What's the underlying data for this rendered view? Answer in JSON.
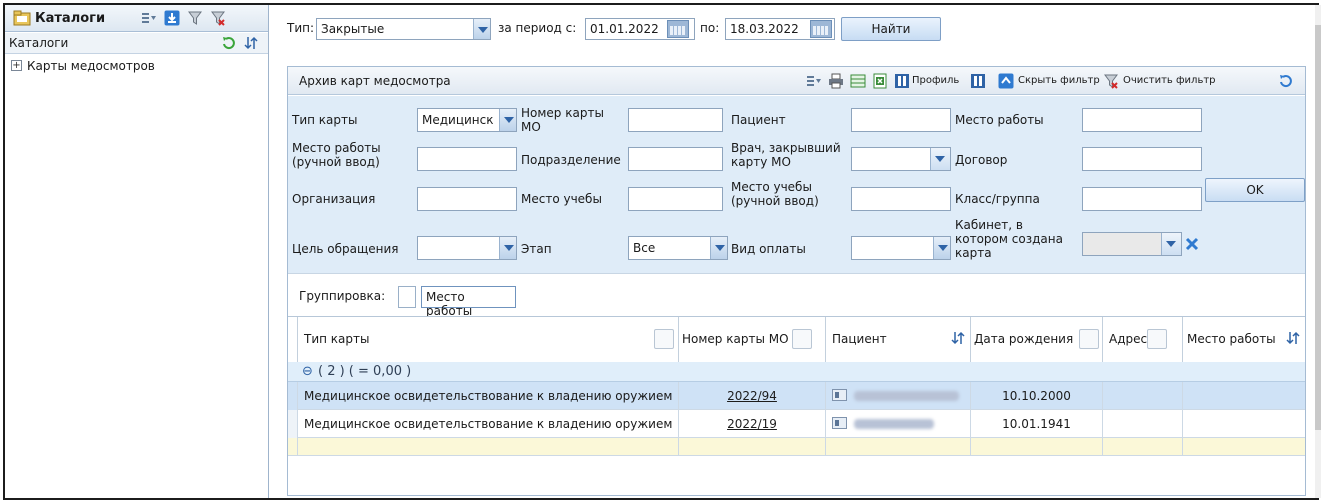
{
  "sidebar": {
    "title": "Каталоги",
    "header_label": "Каталоги",
    "tree": [
      {
        "label": "Карты медосмотров",
        "expander": "+"
      }
    ]
  },
  "toolbar": {
    "type_label": "Тип:",
    "type_value": "Закрытые",
    "period_from_label": "за период с:",
    "date_from": "01.01.2022",
    "period_to_label": "по:",
    "date_to": "18.03.2022",
    "find_button": "Найти"
  },
  "archive": {
    "title": "Архив карт медосмотра",
    "profile_label": "Профиль",
    "hide_filter_label": "Скрыть фильтр",
    "clear_filter_label": "Очистить фильтр"
  },
  "filter": {
    "card_type_label": "Тип карты",
    "card_type_value": "Медицинск",
    "card_number_label": "Номер карты МО",
    "patient_label": "Пациент",
    "workplace_label": "Место работы",
    "workplace_manual_label": "Место работы (ручной ввод)",
    "department_label": "Подразделение",
    "doctor_closed_label": "Врач, закрывший карту МО",
    "contract_label": "Договор",
    "organization_label": "Организация",
    "study_place_label": "Место учебы",
    "study_place_manual_label": "Место учебы (ручной ввод)",
    "class_group_label": "Класс/группа",
    "purpose_label": "Цель обращения",
    "stage_label": "Этап",
    "stage_value": "Все",
    "payment_label": "Вид оплаты",
    "cabinet_label": "Кабинет, в котором создана карта",
    "ok_button": "OK"
  },
  "grouping": {
    "label": "Группировка:",
    "chip": "Место работы"
  },
  "grid": {
    "columns": [
      "Тип карты",
      "Номер карты МО",
      "Пациент",
      "Дата рождения",
      "Адрес",
      "Место работы"
    ],
    "group_row": {
      "symbol": "⊖",
      "text": "( 2 ) ( = 0,00 )"
    },
    "rows": [
      {
        "type": "Медицинское освидетельствование к владению оружием",
        "number": "2022/94",
        "birth": "10.10.2000"
      },
      {
        "type": "Медицинское освидетельствование к владению оружием",
        "number": "2022/19",
        "birth": "10.01.1941"
      }
    ]
  },
  "colors": {
    "accent": "#2f63a6",
    "filter_bg": "#dfecf8",
    "selected_row": "#cfe2f6",
    "new_row": "#fbf8d8"
  }
}
